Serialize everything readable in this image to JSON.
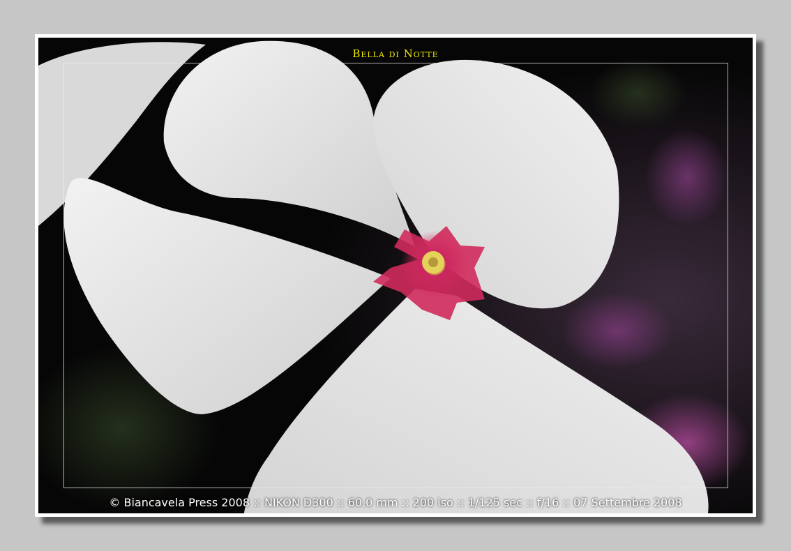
{
  "title": "Bella di Notte",
  "caption": "© Biancavela Press 2008 :: NIKON D300 :: 60.0 mm :: 200 iso :: 1/125 sec :: f/16 :: 07 Settembre 2008",
  "colors": {
    "page_background": "#c6c6c6",
    "frame": "#ffffff",
    "photo_background": "#050505",
    "title": "#f2ee00",
    "caption": "#ffffff",
    "petal": "#e9e9e9",
    "flower_eye": "#d8245a",
    "flower_center": "#e8d85a"
  }
}
